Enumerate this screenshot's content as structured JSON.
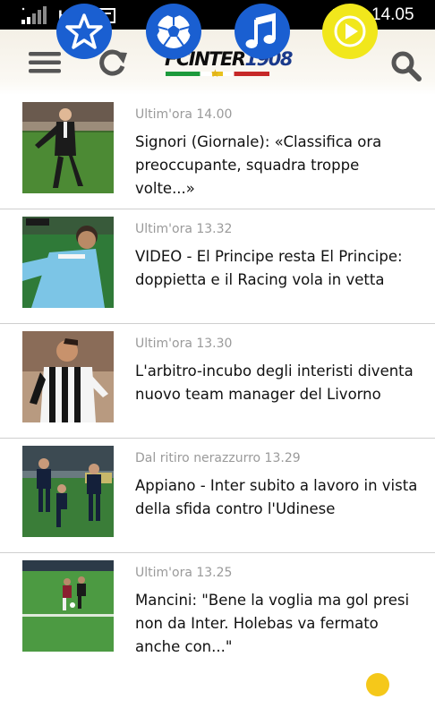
{
  "status_bar": {
    "network_type": "H+",
    "time": "14.05",
    "icons": [
      "signal-icon",
      "message-icon",
      "battery-icon"
    ]
  },
  "header": {
    "logo_text_prefix": "FCINTER",
    "logo_text_number": "1908",
    "icons": [
      "menu-icon",
      "refresh-icon",
      "search-icon"
    ]
  },
  "news": [
    {
      "meta": "Ultim'ora 14.00",
      "title": "Signori (Giornale): «Classifica ora preoccupante, squadra troppe volte...»"
    },
    {
      "meta": "Ultim'ora 13.32",
      "title": "VIDEO - El Principe resta El Principe: doppietta e il Racing vola in vetta"
    },
    {
      "meta": "Ultim'ora 13.30",
      "title": "L'arbitro-incubo degli interisti diventa nuovo team manager del Livorno"
    },
    {
      "meta": "Dal ritiro nerazzurro 13.29",
      "title": "Appiano - Inter subito a lavoro in vista della sfida contro l'Udinese"
    },
    {
      "meta": "Ultim'ora 13.25",
      "title": "Mancini: \"Bene la voglia ma gol presi non da Inter. Holebas va fermato anche con...\""
    }
  ],
  "bottom_bar": {
    "buttons": [
      "star-icon",
      "soccer-ball-icon",
      "music-note-icon",
      "play-icon"
    ]
  },
  "colors": {
    "accent_blue": "#1a5fd1",
    "accent_yellow": "#f1e71c",
    "meta_gray": "#9a9a9a",
    "divider": "#cfcfcf"
  }
}
